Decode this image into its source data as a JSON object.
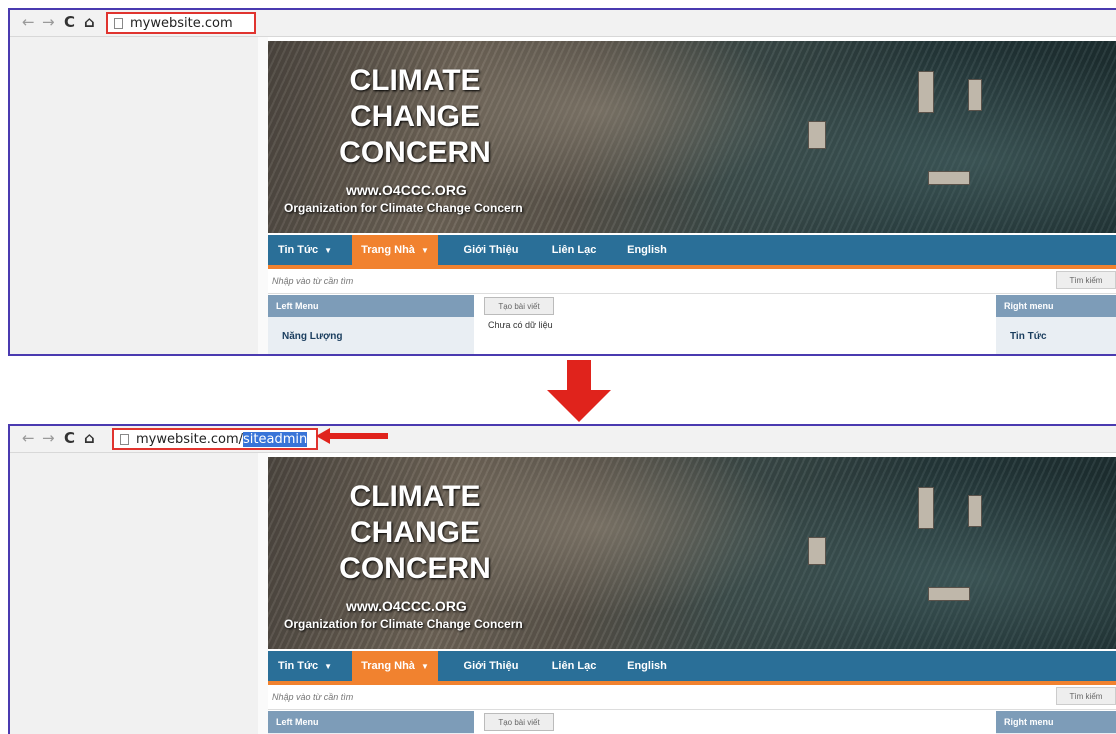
{
  "colors": {
    "frame_border": "#4a3ab0",
    "highlight_red": "#e0342f",
    "nav_blue": "#2a6f98",
    "nav_orange": "#f1822f",
    "url_selection": "#3874d8"
  },
  "icons": [
    "back-arrow-icon",
    "forward-arrow-icon",
    "reload-icon",
    "home-icon",
    "page-icon",
    "down-arrow-icon",
    "left-arrow-icon"
  ],
  "before": {
    "url": "mywebsite.com"
  },
  "after": {
    "url_base": "mywebsite.com/",
    "url_selected": "siteadmin"
  },
  "site": {
    "banner": {
      "title_line1": "CLIMATE",
      "title_line2": "CHANGE",
      "title_line3": "CONCERN",
      "website": "www.O4CCC.ORG",
      "organization": "Organization for Climate Change Concern"
    },
    "nav": {
      "items": [
        "Tin Tức",
        "Trang Nhà",
        "Giới Thiệu",
        "Liên Lạc",
        "English"
      ],
      "active": "Trang Nhà"
    },
    "search": {
      "placeholder": "Nhập vào từ cần tìm",
      "button": "Tìm kiếm"
    },
    "left_menu": {
      "title": "Left Menu",
      "items": [
        "Năng Lượng"
      ]
    },
    "center": {
      "new_post_button": "Tạo bài viết",
      "no_data": "Chưa có dữ liệu"
    },
    "right_menu": {
      "title": "Right menu",
      "items": [
        "Tin Tức"
      ]
    }
  }
}
